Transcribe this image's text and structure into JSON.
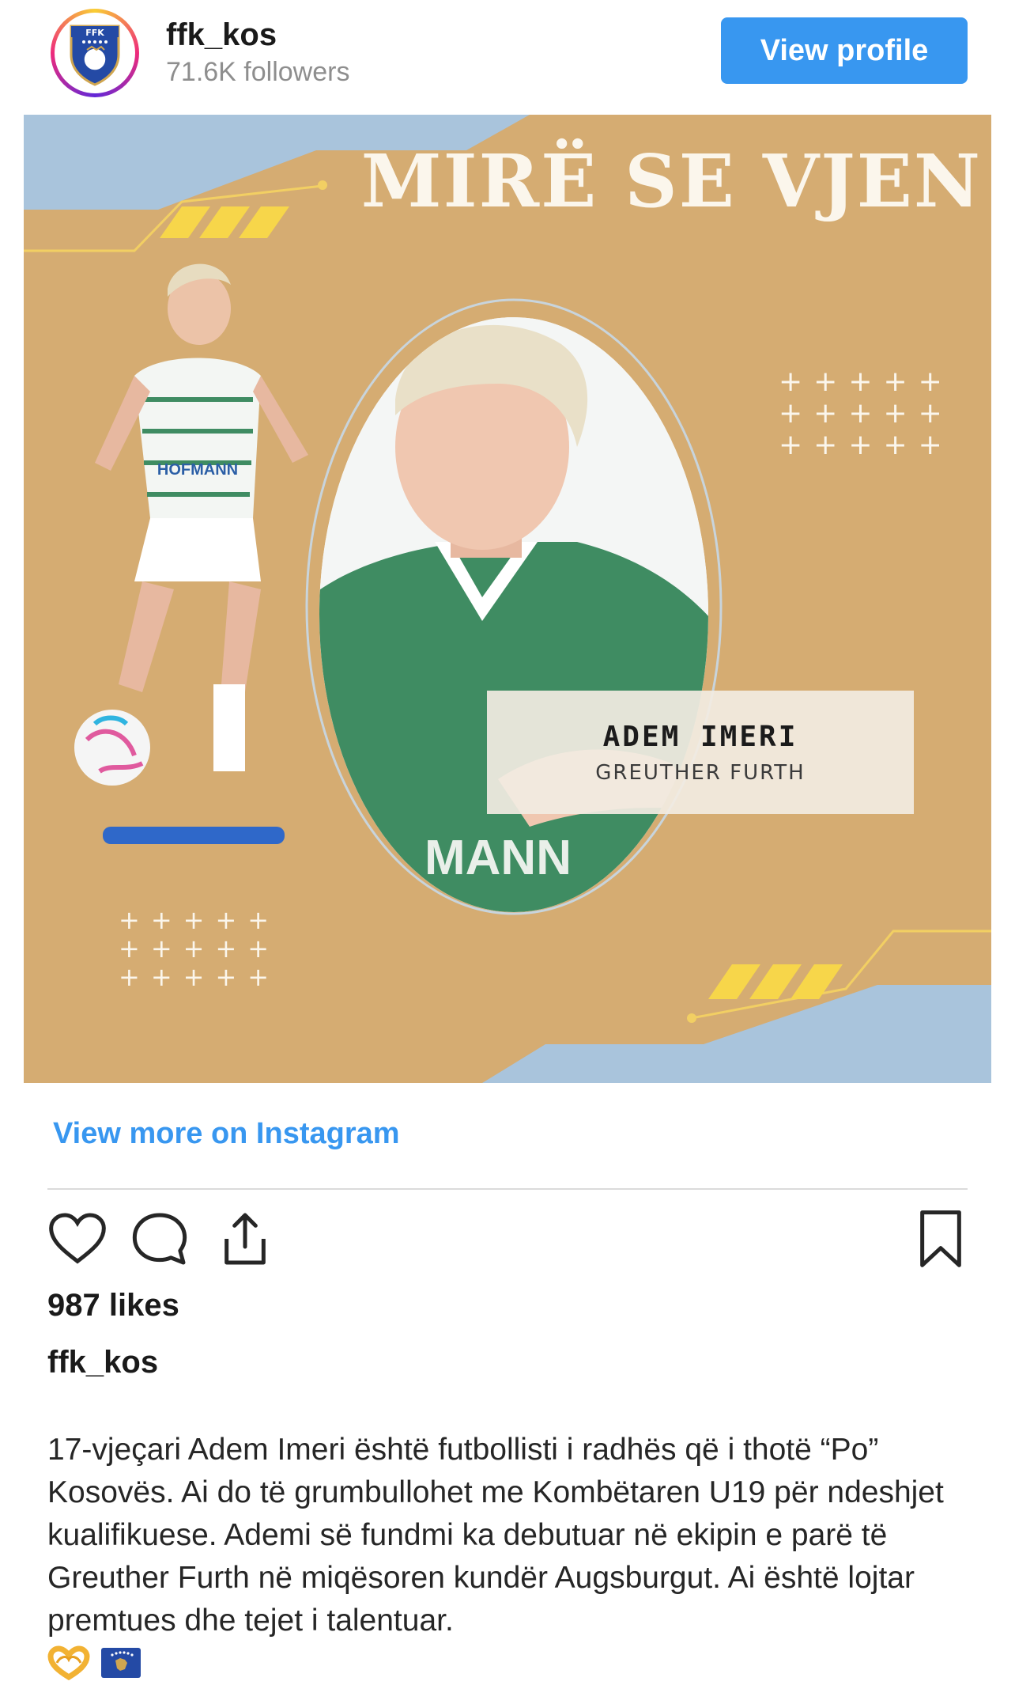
{
  "header": {
    "username": "ffk_kos",
    "followers": "71.6K followers",
    "view_profile_label": "View profile",
    "avatar_text": "FFK"
  },
  "post": {
    "welcome_title": "MIRË SE VJEN",
    "player_name": "ADEM IMERI",
    "player_club": "GREUTHER FURTH",
    "shirt_sponsor": "HOFMANN",
    "shirt_sponsor_partial": "MANN"
  },
  "footer": {
    "view_more_label": "View more on Instagram",
    "likes": "987 likes",
    "caption_username": "ffk_kos",
    "caption_text": "17-vjeçari Adem Imeri është futbollisti i radhës që i thotë “Po” Kosovës. Ai do të grumbullohet me Kombëtaren U19 për ndeshjet kualifikuese. Ademi së fundmi ka debutuar në ekipin e parë të Greuther Furth në miqësoren kundër Augsburgut. Ai është lojtar premtues dhe tejet i talentuar."
  },
  "icons": {
    "like": "heart-icon",
    "comment": "comment-icon",
    "share": "share-icon",
    "save": "bookmark-icon",
    "emoji_1": "heart-hands-emoji",
    "emoji_2": "kosovo-flag-emoji"
  },
  "colors": {
    "accent_blue": "#3897f0",
    "poster_tan": "#d5ac72",
    "poster_blue": "#a9c4dc",
    "poster_yellow": "#f7d64a",
    "jersey_green": "#3f8c62",
    "kosovo_blue": "#244aa5",
    "kosovo_gold": "#d0a650"
  }
}
